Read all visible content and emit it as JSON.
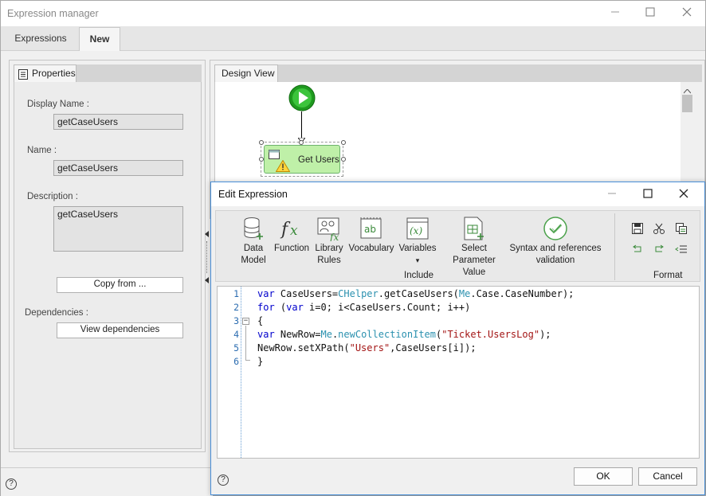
{
  "window": {
    "title": "Expression manager",
    "minimize_icon": "minimize-icon",
    "maximize_icon": "maximize-icon",
    "close_icon": "close-icon"
  },
  "tabs": [
    {
      "label": "Expressions",
      "active": false
    },
    {
      "label": "New",
      "active": true
    }
  ],
  "properties": {
    "tab_label": "Properties",
    "display_name_label": "Display Name :",
    "display_name_value": "getCaseUsers",
    "name_label": "Name :",
    "name_value": "getCaseUsers",
    "description_label": "Description :",
    "description_value": "getCaseUsers",
    "copy_from_label": "Copy from ...",
    "dependencies_label": "Dependencies :",
    "view_dependencies_label": "View dependencies"
  },
  "design_view": {
    "tab_label": "Design View",
    "task_label": "Get Users"
  },
  "dialog": {
    "title": "Edit Expression",
    "ribbon": {
      "buttons": [
        {
          "label_line1": "Data",
          "label_line2": "Model",
          "icon": "database-icon"
        },
        {
          "label_line1": "Function",
          "label_line2": "",
          "icon": "function-icon"
        },
        {
          "label_line1": "Library",
          "label_line2": "Rules",
          "icon": "library-rules-icon"
        },
        {
          "label_line1": "Vocabulary",
          "label_line2": "",
          "icon": "vocabulary-icon"
        },
        {
          "label_line1": "Variables",
          "label_line2": "▾",
          "icon": "variables-icon"
        },
        {
          "label_line1": "Select Parameter",
          "label_line2": "Value",
          "icon": "select-parameter-icon"
        },
        {
          "label_line1": "Syntax and references",
          "label_line2": "validation",
          "icon": "validation-check-icon"
        }
      ],
      "include_group_label": "Include",
      "format_group_label": "Format"
    },
    "code_lines": [
      {
        "num": "1"
      },
      {
        "num": "2"
      },
      {
        "num": "3"
      },
      {
        "num": "4"
      },
      {
        "num": "5"
      },
      {
        "num": "6"
      }
    ],
    "code": {
      "l1_kw": "var",
      "l1_a": " CaseUsers=",
      "l1_obj": "CHelper",
      "l1_b": ".getCaseUsers(",
      "l1_me": "Me",
      "l1_c": ".Case.CaseNumber);",
      "l2_kw1": "for",
      "l2_a": " (",
      "l2_kw2": "var",
      "l2_b": " i=0; i<CaseUsers.Count; i++)",
      "l3": "{",
      "l4_kw": "var",
      "l4_a": " NewRow=",
      "l4_me": "Me",
      "l4_b": ".",
      "l4_fn": "newCollectionItem",
      "l4_c": "(",
      "l4_str": "\"Ticket.UsersLog\"",
      "l4_d": ");",
      "l5_a": "NewRow.setXPath(",
      "l5_str": "\"Users\"",
      "l5_b": ",CaseUsers[i]);",
      "l6": "}"
    },
    "ok_label": "OK",
    "cancel_label": "Cancel"
  },
  "help_glyph": "?",
  "colors": {
    "dialog_border": "#4a90d9",
    "start_green": "#1f9a1f",
    "task_fill": "#bff0a8",
    "code_keyword": "#0000cc",
    "code_object": "#2b91af",
    "code_string": "#a31515"
  }
}
